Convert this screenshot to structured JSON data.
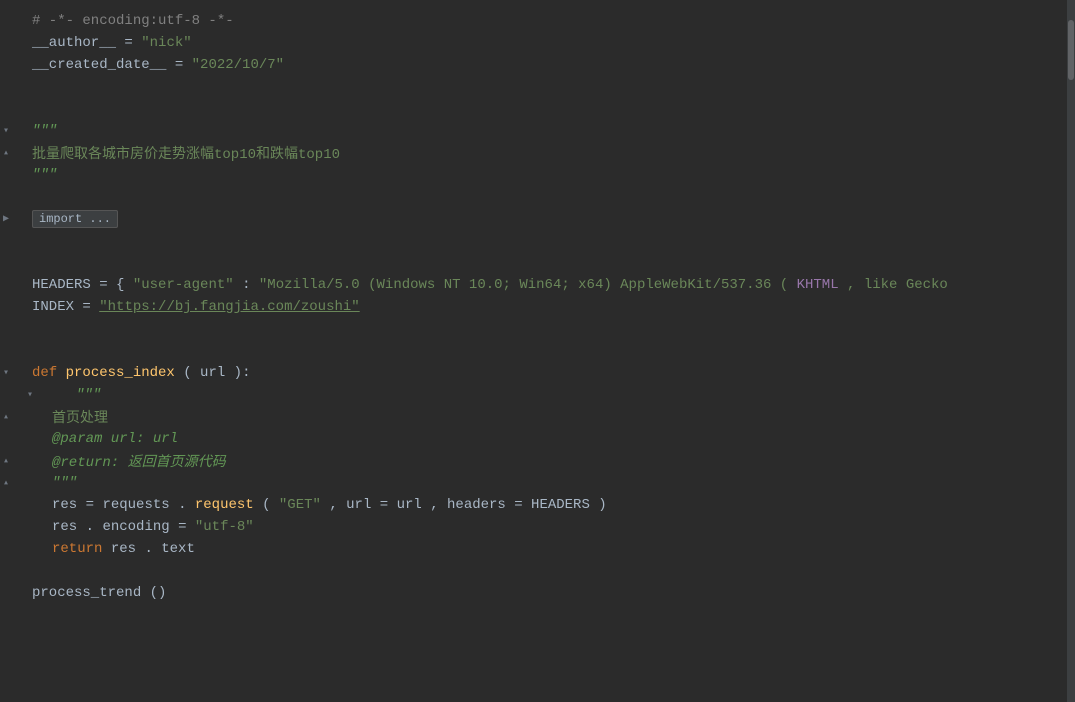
{
  "editor": {
    "background": "#2b2b2b",
    "lines": [
      {
        "id": 1,
        "type": "comment",
        "content": "# -*- encoding:utf-8 -*-"
      },
      {
        "id": 2,
        "type": "assignment",
        "var": "__author__",
        "val": "\"nick\""
      },
      {
        "id": 3,
        "type": "assignment",
        "var": "__created_date__",
        "val": "\"2022/10/7\""
      },
      {
        "id": 4,
        "type": "blank"
      },
      {
        "id": 5,
        "type": "blank"
      },
      {
        "id": 6,
        "type": "docstring_open",
        "content": "\"\"\""
      },
      {
        "id": 7,
        "type": "docstring_chinese",
        "content": "批量爬取各城市房价走势涨幅top10和跌幅top10"
      },
      {
        "id": 8,
        "type": "docstring_close",
        "content": "\"\"\""
      },
      {
        "id": 9,
        "type": "blank"
      },
      {
        "id": 10,
        "type": "import_collapsed",
        "content": "import ..."
      },
      {
        "id": 11,
        "type": "blank"
      },
      {
        "id": 12,
        "type": "blank"
      },
      {
        "id": 13,
        "type": "headers",
        "content": "HEADERS = {\"user-agent\":\"Mozilla/5.0 (Windows NT 10.0; Win64; x64) AppleWebKit/537.36 (KHTML, like Gecko"
      },
      {
        "id": 14,
        "type": "index",
        "var": "INDEX",
        "val": "\"https://bj.fangjia.com/zoushi\""
      },
      {
        "id": 15,
        "type": "blank"
      },
      {
        "id": 16,
        "type": "blank"
      },
      {
        "id": 17,
        "type": "funcdef",
        "content": "def process_index(url):"
      },
      {
        "id": 18,
        "type": "docstring_open_indent",
        "content": "\"\"\""
      },
      {
        "id": 19,
        "type": "docstring_chinese_indent",
        "content": "首页处理"
      },
      {
        "id": 20,
        "type": "docstring_param",
        "content": "@param url: url"
      },
      {
        "id": 21,
        "type": "docstring_return",
        "content": "@return: 返回首页源代码"
      },
      {
        "id": 22,
        "type": "docstring_close_indent",
        "content": "\"\"\""
      },
      {
        "id": 23,
        "type": "code_res",
        "content": "res = requests.request(\"GET\", url=url, headers=HEADERS)"
      },
      {
        "id": 24,
        "type": "code_encoding",
        "content": "res.encoding = \"utf-8\""
      },
      {
        "id": 25,
        "type": "code_return",
        "content": "return res.text"
      },
      {
        "id": 26,
        "type": "blank"
      },
      {
        "id": 27,
        "type": "next_func",
        "content": "process_trend()"
      }
    ]
  }
}
